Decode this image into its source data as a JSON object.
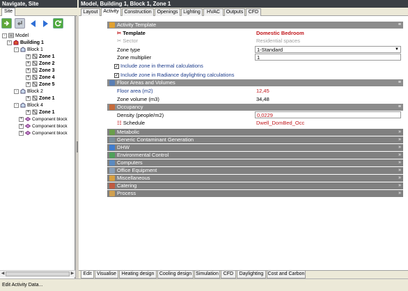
{
  "left": {
    "title": "Navigate, Site",
    "tab": "Site",
    "tree": [
      {
        "label": "Model",
        "bold": false,
        "expander": "-",
        "icon": "model-icon"
      },
      {
        "label": "Building 1",
        "bold": true,
        "expander": "-",
        "icon": "building-icon"
      },
      {
        "label": "Block 1",
        "bold": false,
        "expander": "-",
        "icon": "block-icon"
      },
      {
        "label": "Zone 1",
        "bold": true,
        "expander": "+",
        "icon": "zone-icon"
      },
      {
        "label": "Zone 2",
        "bold": true,
        "expander": "+",
        "icon": "zone-icon"
      },
      {
        "label": "Zone 3",
        "bold": true,
        "expander": "+",
        "icon": "zone-icon"
      },
      {
        "label": "Zone 4",
        "bold": true,
        "expander": "+",
        "icon": "zone-icon"
      },
      {
        "label": "Zone 5",
        "bold": true,
        "expander": "+",
        "icon": "zone-icon"
      },
      {
        "label": "Block 2",
        "bold": false,
        "expander": "-",
        "icon": "block-icon"
      },
      {
        "label": "Zone 1",
        "bold": true,
        "expander": "+",
        "icon": "zone-icon"
      },
      {
        "label": "Block 4",
        "bold": false,
        "expander": "-",
        "icon": "block-icon"
      },
      {
        "label": "Zone 1",
        "bold": true,
        "expander": "+",
        "icon": "zone-icon"
      },
      {
        "label": "Component block",
        "bold": false,
        "expander": "+",
        "icon": "component-block-icon"
      },
      {
        "label": "Component block",
        "bold": false,
        "expander": "+",
        "icon": "component-block-icon"
      },
      {
        "label": "Component block",
        "bold": false,
        "expander": "+",
        "icon": "component-block-icon"
      }
    ]
  },
  "right": {
    "title": "Model, Building 1, Block 1, Zone 1",
    "tabs": [
      "Layout",
      "Activity",
      "Construction",
      "Openings",
      "Lighting",
      "HVAC",
      "Outputs",
      "CFD"
    ],
    "active_tab": "Activity"
  },
  "form": {
    "activity_template": {
      "header": "Activity Template",
      "template_label": "Template",
      "template_value": "Domestic Bedroom",
      "sector_label": "Sector",
      "sector_value": "Residential spaces",
      "zone_type_label": "Zone type",
      "zone_type_value": "1-Standard",
      "zone_multiplier_label": "Zone multiplier",
      "zone_multiplier_value": "1",
      "include_thermal_label": "Include zone in thermal calculations",
      "include_thermal_checked": true,
      "include_radiance_label": "Include zone in Radiance daylighting calculations",
      "include_radiance_checked": true
    },
    "floor_areas": {
      "header": "Floor Areas and Volumes",
      "floor_area_label": "Floor area (m2)",
      "floor_area_value": "12,45",
      "zone_volume_label": "Zone volume (m3)",
      "zone_volume_value": "34,48"
    },
    "occupancy": {
      "header": "Occupancy",
      "density_label": "Density (people/m2)",
      "density_value": "0,0229",
      "schedule_label": "Schedule",
      "schedule_value": "Dwell_DomBed_Occ"
    },
    "collapsed_sections": [
      "Metabolic",
      "Generic Contaminant Generation",
      "DHW",
      "Environmental Control",
      "Computers",
      "Office Equipment",
      "Miscellaneous",
      "Catering",
      "Process"
    ]
  },
  "bottom_tabs": [
    "Edit",
    "Visualise",
    "Heating design",
    "Cooling design",
    "Simulation",
    "CFD",
    "Daylighting",
    "Cost and Carbon"
  ],
  "bottom_active": "Edit",
  "status": "Edit Activity Data...",
  "colors": {
    "section_header": "#808080",
    "accent_red": "#c0161b",
    "label_blue": "#1a3a8a",
    "titlebar": "#3b3f44"
  }
}
